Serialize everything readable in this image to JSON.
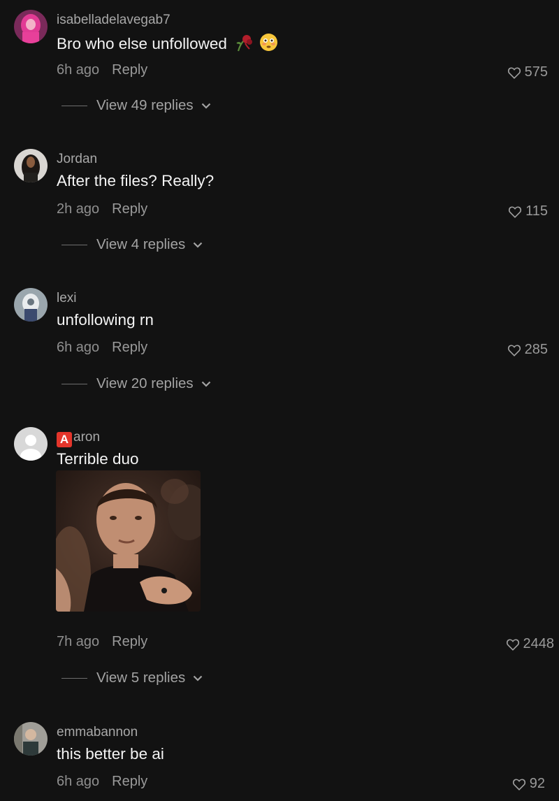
{
  "comments": [
    {
      "username": "isabelladelavegab7",
      "text": "Bro who else unfollowed",
      "time": "6h ago",
      "reply_label": "Reply",
      "likes": "575",
      "view_replies": "View 49 replies",
      "text_emojis": [
        "wilted-rose-emoji",
        "flushed-face-emoji"
      ],
      "avatar_color": "#d6338a"
    },
    {
      "username": "Jordan",
      "text": "After the files? Really?",
      "time": "2h ago",
      "reply_label": "Reply",
      "likes": "115",
      "view_replies": "View 4 replies",
      "avatar_color": "#c9c6c2"
    },
    {
      "username": "lexi",
      "text": "unfollowing rn",
      "time": "6h ago",
      "reply_label": "Reply",
      "likes": "285",
      "view_replies": "View 20 replies",
      "avatar_color": "#7e8b93"
    },
    {
      "username": "aron",
      "username_prefix_badge": "A",
      "text": "Terrible duo",
      "time": "7h ago",
      "reply_label": "Reply",
      "likes": "2448",
      "view_replies": "View 5 replies",
      "has_gif": true,
      "avatar_color": "#d8d8d8"
    },
    {
      "username": "emmabannon",
      "text": "this better be ai",
      "time": "6h ago",
      "reply_label": "Reply",
      "likes": "92",
      "avatar_color": "#8b8a86"
    }
  ],
  "colors": {
    "background": "#121212",
    "username": "#a8a8a8",
    "text": "#f4f4f4",
    "meta": "#8f8f8f",
    "badge": "#e4352b"
  }
}
